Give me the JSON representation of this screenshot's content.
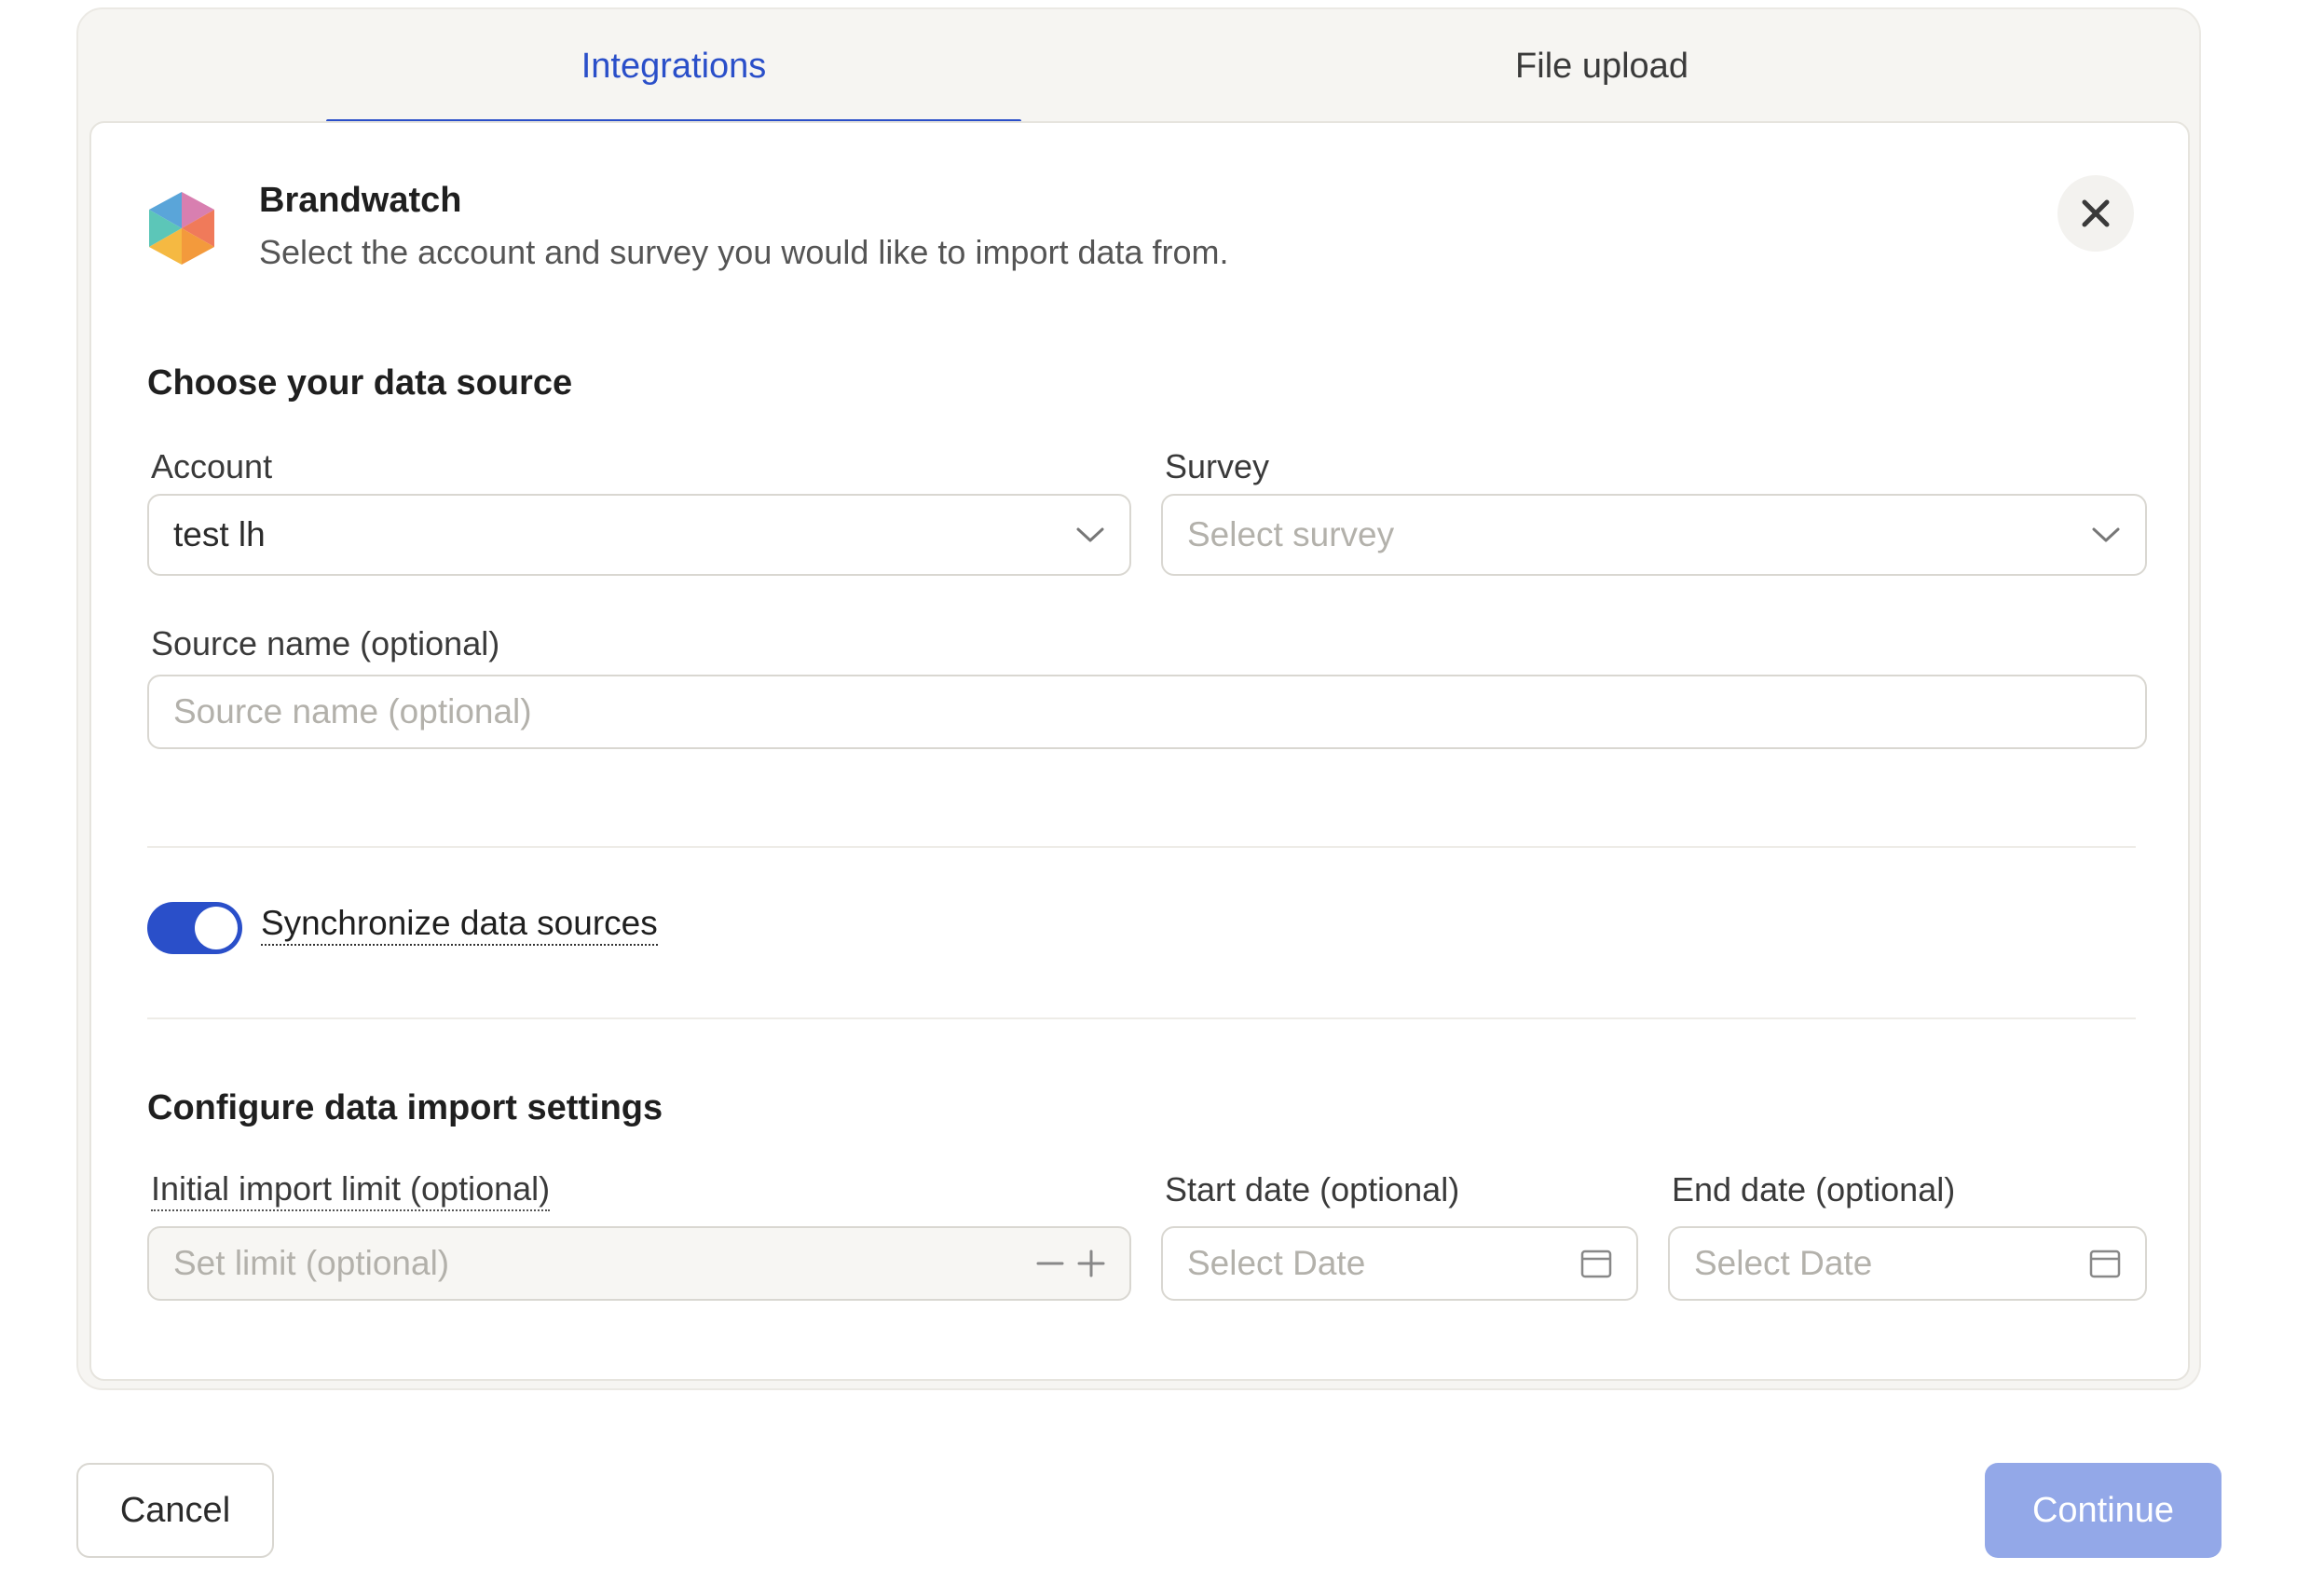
{
  "tabs": [
    {
      "label": "Integrations",
      "active": true
    },
    {
      "label": "File upload",
      "active": false
    }
  ],
  "header": {
    "title": "Brandwatch",
    "description": "Select the account and survey you would like to import data from."
  },
  "data_source": {
    "section_title": "Choose your data source",
    "account": {
      "label": "Account",
      "value": "test lh"
    },
    "survey": {
      "label": "Survey",
      "placeholder": "Select survey"
    },
    "source_name": {
      "label": "Source name (optional)",
      "placeholder": "Source name (optional)"
    }
  },
  "sync": {
    "label": "Synchronize data sources",
    "enabled": true
  },
  "import_settings": {
    "section_title": "Configure data import settings",
    "limit": {
      "label": "Initial import limit (optional)",
      "placeholder": "Set limit (optional)"
    },
    "start_date": {
      "label": "Start date (optional)",
      "placeholder": "Select Date"
    },
    "end_date": {
      "label": "End date (optional)",
      "placeholder": "Select Date"
    }
  },
  "footer": {
    "cancel_label": "Cancel",
    "continue_label": "Continue"
  },
  "colors": {
    "accent": "#2a4fc9",
    "continue_disabled": "#93a8e8"
  },
  "icons": {
    "logo": "brandwatch-logo-icon",
    "close": "close-icon",
    "dropdown": "chevron-down-icon",
    "calendar": "calendar-icon",
    "minus": "minus-icon",
    "plus": "plus-icon"
  }
}
